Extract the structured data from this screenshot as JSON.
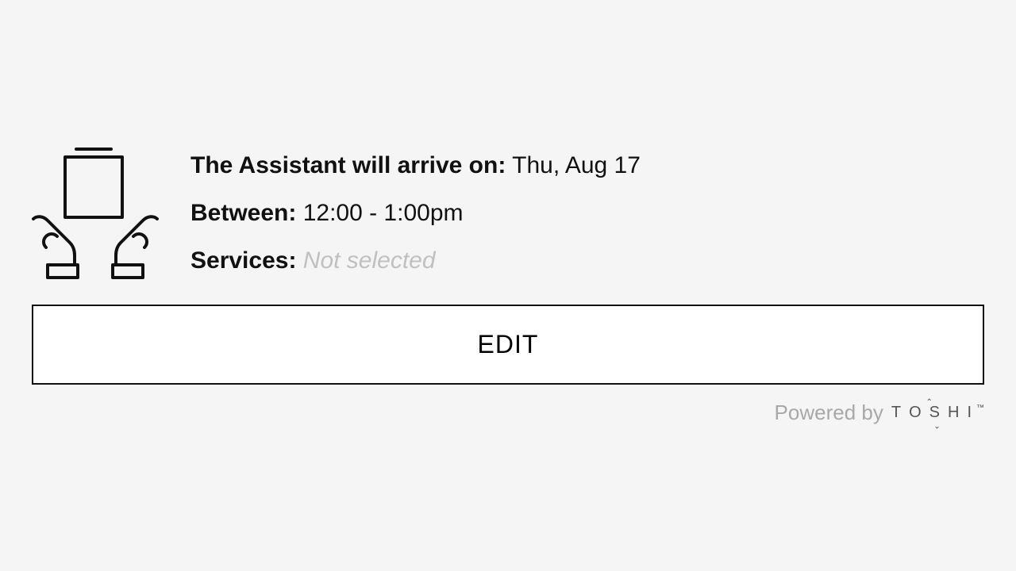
{
  "summary": {
    "arrive_label": "The Assistant will arrive on:",
    "arrive_value": "Thu, Aug 17",
    "between_label": "Between:",
    "between_value": "12:00 - 1:00pm",
    "services_label": "Services:",
    "services_value": "Not selected"
  },
  "actions": {
    "edit_label": "EDIT"
  },
  "footer": {
    "powered_by": "Powered by",
    "brand": "TOSHI",
    "tm": "™"
  }
}
